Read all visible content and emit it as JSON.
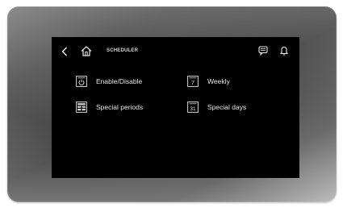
{
  "header": {
    "title": "SCHEDULER",
    "icons": [
      "back-arrow-icon",
      "home-icon",
      "message-icon",
      "bell-icon"
    ]
  },
  "menu": {
    "enable_disable": {
      "label": "Enable/Disable",
      "icon": "power-icon"
    },
    "weekly": {
      "label": "Weekly",
      "icon": "calendar-7-icon",
      "icon_text": "7"
    },
    "special_periods": {
      "label": "Special periods",
      "icon": "calendar-grid-icon"
    },
    "special_days": {
      "label": "Special days",
      "icon": "calendar-31-icon",
      "icon_text": "31"
    }
  },
  "colors": {
    "screen": "#000000",
    "text": "#e6e6e6",
    "bezel": "#4a4a4a"
  }
}
